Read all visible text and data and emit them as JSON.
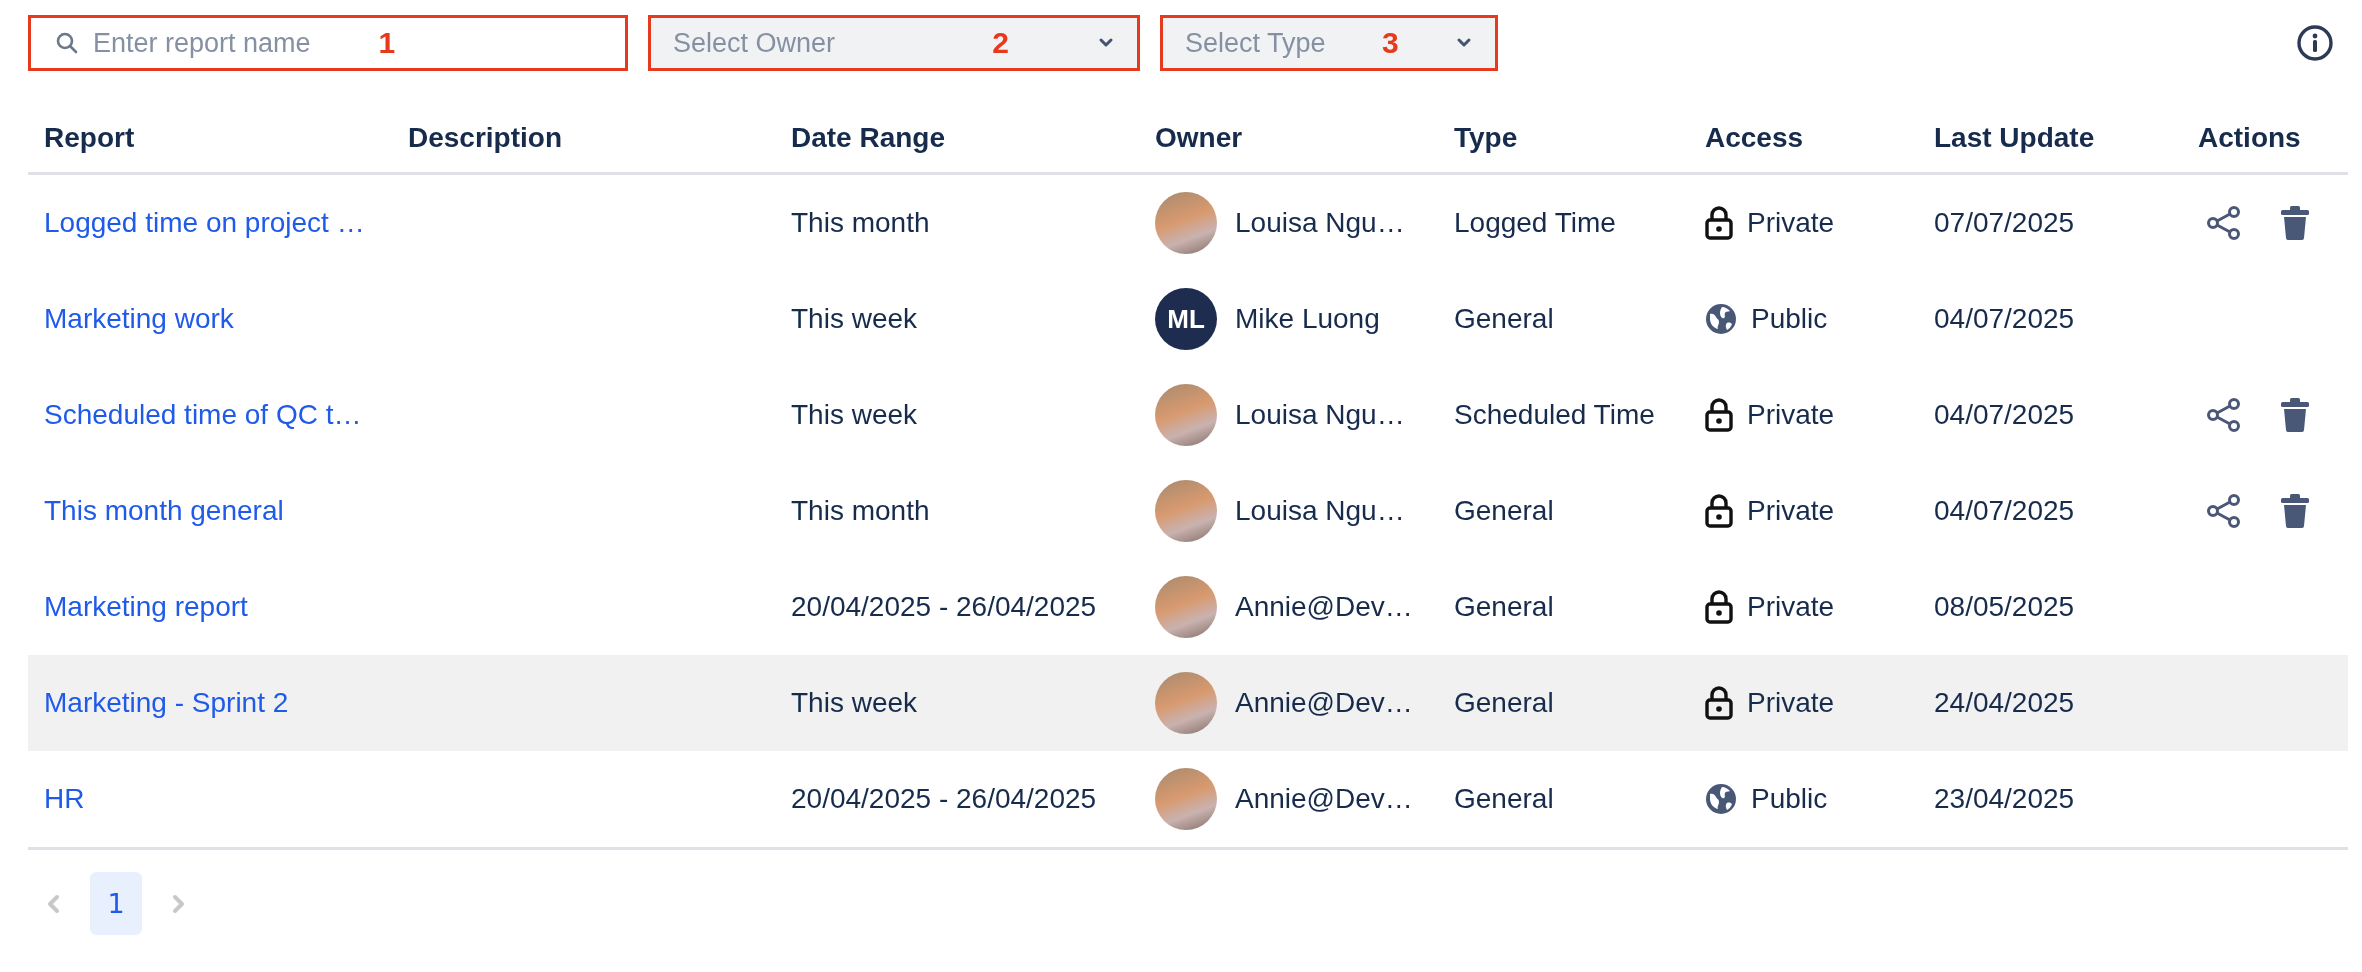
{
  "filters": [
    {
      "kind": "search",
      "placeholder": "Enter report name",
      "marker": "1"
    },
    {
      "kind": "select",
      "placeholder": "Select Owner",
      "marker": "2"
    },
    {
      "kind": "select",
      "placeholder": "Select Type",
      "marker": "3"
    }
  ],
  "table": {
    "columns": [
      "Report",
      "Description",
      "Date Range",
      "Owner",
      "Type",
      "Access",
      "Last Update",
      "Actions"
    ],
    "rows": [
      {
        "report": "Logged time on project …",
        "date_range": "This month",
        "owner": {
          "kind": "photo",
          "name": "Louisa Ngu…"
        },
        "type": "Logged Time",
        "access": {
          "kind": "private",
          "label": "Private"
        },
        "last_update": "07/07/2025",
        "actions": true,
        "highlighted": false
      },
      {
        "report": "Marketing work",
        "date_range": "This week",
        "owner": {
          "kind": "initials",
          "initials": "ML",
          "name": "Mike Luong"
        },
        "type": "General",
        "access": {
          "kind": "public",
          "label": "Public"
        },
        "last_update": "04/07/2025",
        "actions": false,
        "highlighted": false
      },
      {
        "report": "Scheduled time of QC t…",
        "date_range": "This week",
        "owner": {
          "kind": "photo",
          "name": "Louisa Ngu…"
        },
        "type": "Scheduled Time",
        "access": {
          "kind": "private",
          "label": "Private"
        },
        "last_update": "04/07/2025",
        "actions": true,
        "highlighted": false
      },
      {
        "report": "This month general",
        "date_range": "This month",
        "owner": {
          "kind": "photo",
          "name": "Louisa Ngu…"
        },
        "type": "General",
        "access": {
          "kind": "private",
          "label": "Private"
        },
        "last_update": "04/07/2025",
        "actions": true,
        "highlighted": false
      },
      {
        "report": "Marketing report",
        "date_range": "20/04/2025 - 26/04/2025",
        "owner": {
          "kind": "photo",
          "name": "Annie@Dev…"
        },
        "type": "General",
        "access": {
          "kind": "private",
          "label": "Private"
        },
        "last_update": "08/05/2025",
        "actions": false,
        "highlighted": false
      },
      {
        "report": "Marketing - Sprint 2",
        "date_range": "This week",
        "owner": {
          "kind": "photo",
          "name": "Annie@Dev…"
        },
        "type": "General",
        "access": {
          "kind": "private",
          "label": "Private"
        },
        "last_update": "24/04/2025",
        "actions": false,
        "highlighted": true
      },
      {
        "report": "HR",
        "date_range": "20/04/2025 - 26/04/2025",
        "owner": {
          "kind": "photo",
          "name": "Annie@Dev…"
        },
        "type": "General",
        "access": {
          "kind": "public",
          "label": "Public"
        },
        "last_update": "23/04/2025",
        "actions": false,
        "highlighted": false
      }
    ]
  },
  "pagination": {
    "pages": [
      {
        "label": "1",
        "selected": true
      }
    ]
  }
}
